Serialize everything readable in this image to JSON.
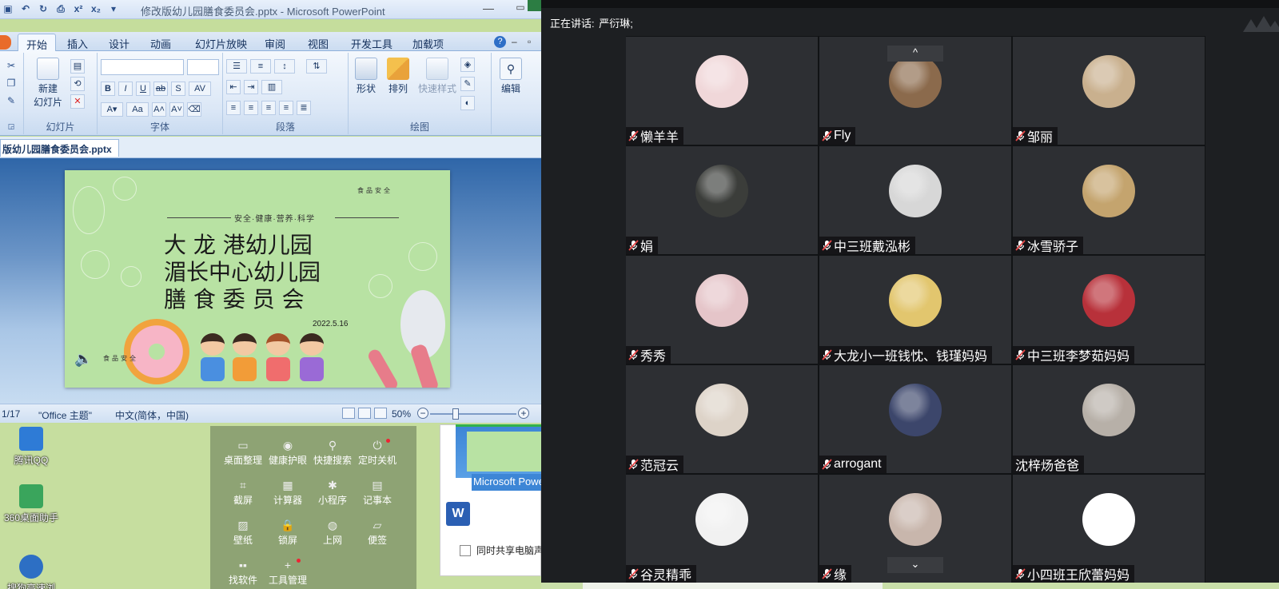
{
  "ppt": {
    "title": "修改版幼儿园膳食委员会.pptx - Microsoft PowerPoint",
    "tabs": [
      "开始",
      "插入",
      "设计",
      "动画",
      "幻灯片放映",
      "审阅",
      "视图",
      "开发工具",
      "加载项"
    ],
    "ribbon": {
      "new_slide_label_1": "新建",
      "new_slide_label_2": "幻灯片",
      "shape_label": "形状",
      "arrange_label": "排列",
      "quick_style_label": "快速样式",
      "edit_label": "编辑",
      "group_slides": "幻灯片",
      "group_font": "字体",
      "group_paragraph": "段落",
      "group_drawing": "绘图"
    },
    "doc_tab": "版幼儿园膳食委员会.pptx",
    "slide": {
      "top_right": "食品安全",
      "slogan": "安全·健康·营养·科学",
      "title_line_1": "大 龙 港幼儿园",
      "title_line_2": "湄长中心幼儿园",
      "title_line_3": "膳 食 委 员 会",
      "date": "2022.5.16",
      "bottom_left": "食品安全"
    },
    "status": {
      "page": "1/17",
      "theme": "\"Office 主题\"",
      "language": "中文(简体，中国)",
      "zoom": "50%",
      "zoom_fraction": 0.3
    }
  },
  "desktop": {
    "icons": [
      "腾讯QQ",
      "360桌面助手",
      "搜狗高速浏览"
    ],
    "tools": [
      {
        "label": "桌面整理",
        "icon": "desktop-icon"
      },
      {
        "label": "健康护眼",
        "icon": "eye-icon"
      },
      {
        "label": "快捷搜索",
        "icon": "search-icon"
      },
      {
        "label": "定时关机",
        "icon": "power-icon"
      },
      {
        "label": "截屏",
        "icon": "crop-icon"
      },
      {
        "label": "计算器",
        "icon": "calculator-icon"
      },
      {
        "label": "小程序",
        "icon": "miniapp-icon"
      },
      {
        "label": "记事本",
        "icon": "notepad-icon"
      },
      {
        "label": "壁纸",
        "icon": "wallpaper-icon"
      },
      {
        "label": "锁屏",
        "icon": "lock-icon"
      },
      {
        "label": "上网",
        "icon": "globe-icon"
      },
      {
        "label": "便签",
        "icon": "sticky-note-icon"
      },
      {
        "label": "找软件",
        "icon": "grid-icon"
      },
      {
        "label": "工具管理",
        "icon": "plus-icon"
      }
    ],
    "preview_label": "Microsoft PowerPoint",
    "share_sound_label": "同时共享电脑声音"
  },
  "meeting": {
    "speaking_prefix": "正在讲话:",
    "speaking_name": "严衍琳;",
    "participants": [
      {
        "name": "懒羊羊",
        "muted": true,
        "avatar_color": "#f0d7d9"
      },
      {
        "name": "Fly",
        "muted": true,
        "avatar_color": "#8b6a4c"
      },
      {
        "name": "邹丽",
        "muted": true,
        "avatar_color": "#c9b08e"
      },
      {
        "name": "娟",
        "muted": true,
        "avatar_color": "#3b3d3a"
      },
      {
        "name": "中三班戴泓彬",
        "muted": true,
        "avatar_color": "#d7d7d7"
      },
      {
        "name": "冰雪骄子",
        "muted": true,
        "avatar_color": "#c4a46e"
      },
      {
        "name": "秀秀",
        "muted": true,
        "avatar_color": "#e5c5c9"
      },
      {
        "name": "大龙小一班钱忱、钱瑾妈妈",
        "muted": true,
        "avatar_color": "#e2c66e"
      },
      {
        "name": "中三班李梦茹妈妈",
        "muted": true,
        "avatar_color": "#b8313a"
      },
      {
        "name": "范冠云",
        "muted": true,
        "avatar_color": "#ddd3c8"
      },
      {
        "name": "arrogant",
        "muted": true,
        "avatar_color": "#3c466b"
      },
      {
        "name": "沈梓炀爸爸",
        "muted": false,
        "avatar_color": "#b7b0a8"
      },
      {
        "name": "谷灵精乖",
        "muted": true,
        "avatar_color": "#f1f1f1"
      },
      {
        "name": "缘",
        "muted": true,
        "avatar_color": "#c8b6ac"
      },
      {
        "name": "小四班王欣蕾妈妈",
        "muted": true,
        "avatar_color": "#ffffff"
      }
    ],
    "scroll_up": "^",
    "scroll_down": "⌄"
  },
  "colors": {
    "meeting_bg": "#1d1f22",
    "tile_bg": "#2d2f33",
    "slide_green": "#b8e2a3",
    "ribbon_blue": "#dbe7f6",
    "mic_muted": "#e84a4a"
  }
}
